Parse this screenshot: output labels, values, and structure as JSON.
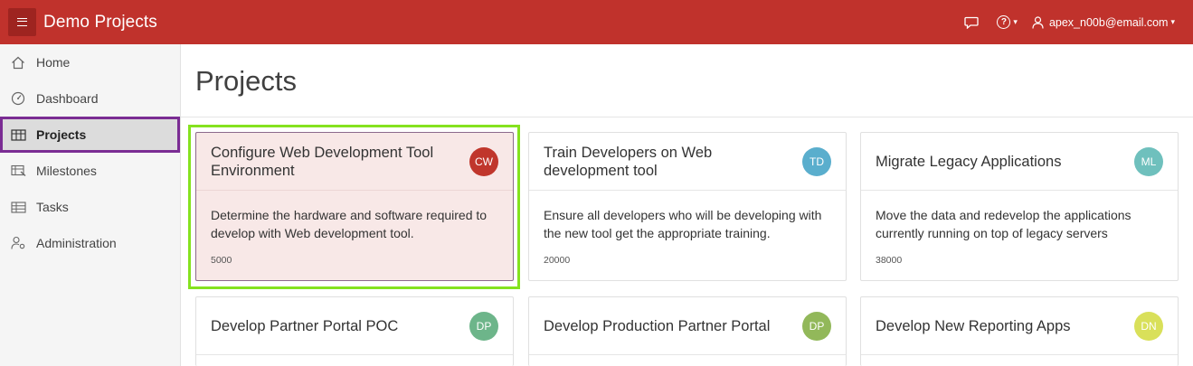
{
  "header": {
    "app_title": "Demo Projects",
    "menu_icon": "hamburger-icon",
    "feedback_icon": "chat-bubble-icon",
    "help_icon": "help-circle-icon",
    "help_glyph": "?",
    "user_icon": "user-icon",
    "user_email": "apex_n00b@email.com",
    "caret": "▾",
    "color": "#c0322c"
  },
  "sidebar": {
    "items": [
      {
        "label": "Home",
        "icon": "home-icon"
      },
      {
        "label": "Dashboard",
        "icon": "dashboard-gauge-icon"
      },
      {
        "label": "Projects",
        "icon": "table-grid-icon",
        "active": true
      },
      {
        "label": "Milestones",
        "icon": "milestone-list-icon"
      },
      {
        "label": "Tasks",
        "icon": "task-table-icon"
      },
      {
        "label": "Administration",
        "icon": "user-settings-icon"
      }
    ]
  },
  "main": {
    "title": "Projects",
    "cards": [
      {
        "title": "Configure Web Development Tool Environment",
        "initials": "CW",
        "avatar_color": "#c0362c",
        "description": "Determine the hardware and software required to develop with Web development tool.",
        "budget": "5000",
        "selected": true
      },
      {
        "title": "Train Developers on Web development tool",
        "initials": "TD",
        "avatar_color": "#5aaecd",
        "description": "Ensure all developers who will be developing with the new tool get the appropriate training.",
        "budget": "20000"
      },
      {
        "title": "Migrate Legacy Applications",
        "initials": "ML",
        "avatar_color": "#6fc0bd",
        "description": "Move the data and redevelop the applications currently running on top of legacy servers",
        "budget": "38000"
      },
      {
        "title": "Develop Partner Portal POC",
        "initials": "DP",
        "avatar_color": "#6db58a"
      },
      {
        "title": "Develop Production Partner Portal",
        "initials": "DP",
        "avatar_color": "#92b85a"
      },
      {
        "title": "Develop New Reporting Apps",
        "initials": "DN",
        "avatar_color": "#d9e05a"
      }
    ]
  }
}
